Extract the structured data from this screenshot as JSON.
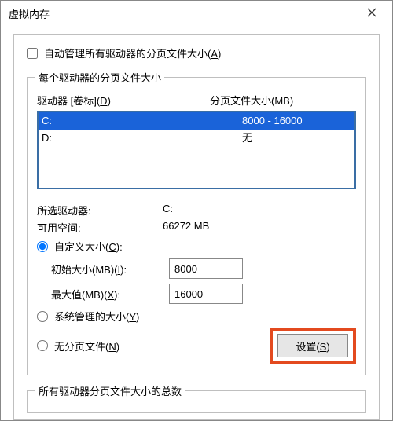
{
  "title": "虚拟内存",
  "auto_manage": {
    "checked": false,
    "label_pre": "自动管理所有驱动器的分页文件大小(",
    "label_u": "A",
    "label_post": ")"
  },
  "fs1": {
    "legend": "每个驱动器的分页文件大小",
    "header_drive_pre": "驱动器 [卷标](",
    "header_drive_u": "D",
    "header_drive_post": ")",
    "header_size": "分页文件大小(MB)",
    "rows": [
      {
        "drive": "C:",
        "size": "8000 - 16000",
        "selected": true
      },
      {
        "drive": "D:",
        "size": "无",
        "selected": false
      }
    ],
    "sel_drive_label": "所选驱动器:",
    "sel_drive_value": "C:",
    "space_label": "可用空间:",
    "space_value": "66272 MB",
    "radio_custom_pre": "自定义大小(",
    "radio_custom_u": "C",
    "radio_custom_post": "):",
    "initial_label_pre": "初始大小(MB)(",
    "initial_label_u": "I",
    "initial_label_post": "):",
    "initial_value": "8000",
    "max_label_pre": "最大值(MB)(",
    "max_label_u": "X",
    "max_label_post": "):",
    "max_value": "16000",
    "radio_sys_pre": "系统管理的大小(",
    "radio_sys_u": "Y",
    "radio_sys_post": ")",
    "radio_none_pre": "无分页文件(",
    "radio_none_u": "N",
    "radio_none_post": ")",
    "set_pre": "设置(",
    "set_u": "S",
    "set_post": ")",
    "radio_selected": "custom"
  },
  "fs2": {
    "legend": "所有驱动器分页文件大小的总数"
  }
}
